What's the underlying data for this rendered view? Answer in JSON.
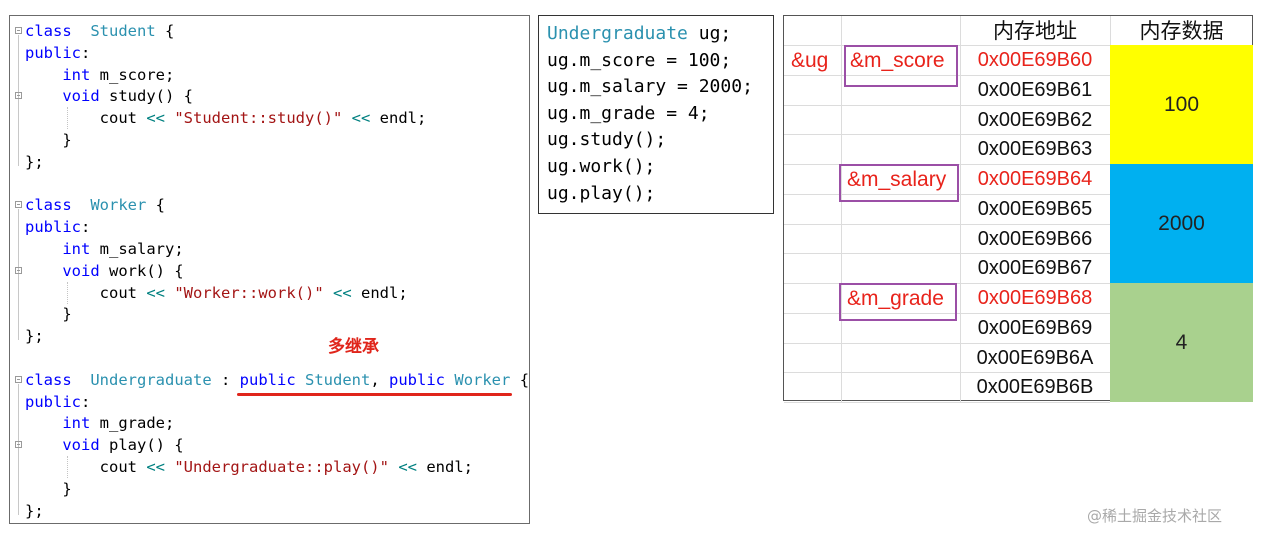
{
  "left_code": {
    "lines": [
      [
        [
          "kw",
          "class"
        ],
        [
          "",
          "  "
        ],
        [
          "ty",
          "Student"
        ],
        [
          "",
          " {"
        ]
      ],
      [
        [
          "kw",
          "public"
        ],
        [
          "",
          ":"
        ]
      ],
      [
        [
          "",
          "    "
        ],
        [
          "kw",
          "int"
        ],
        [
          "",
          " m_score;"
        ]
      ],
      [
        [
          "",
          "    "
        ],
        [
          "kw",
          "void"
        ],
        [
          "",
          " study() {"
        ]
      ],
      [
        [
          "",
          "        cout "
        ],
        [
          "op",
          "<<"
        ],
        [
          "",
          " "
        ],
        [
          "st",
          "\"Student::study()\""
        ],
        [
          "",
          " "
        ],
        [
          "op",
          "<<"
        ],
        [
          "",
          " endl;"
        ]
      ],
      [
        [
          "",
          "    }"
        ]
      ],
      [
        [
          "",
          "};"
        ]
      ],
      [
        [
          "",
          ""
        ]
      ],
      [
        [
          "kw",
          "class"
        ],
        [
          "",
          "  "
        ],
        [
          "ty",
          "Worker"
        ],
        [
          "",
          " {"
        ]
      ],
      [
        [
          "kw",
          "public"
        ],
        [
          "",
          ":"
        ]
      ],
      [
        [
          "",
          "    "
        ],
        [
          "kw",
          "int"
        ],
        [
          "",
          " m_salary;"
        ]
      ],
      [
        [
          "",
          "    "
        ],
        [
          "kw",
          "void"
        ],
        [
          "",
          " work() {"
        ]
      ],
      [
        [
          "",
          "        cout "
        ],
        [
          "op",
          "<<"
        ],
        [
          "",
          " "
        ],
        [
          "st",
          "\"Worker::work()\""
        ],
        [
          "",
          " "
        ],
        [
          "op",
          "<<"
        ],
        [
          "",
          " endl;"
        ]
      ],
      [
        [
          "",
          "    }"
        ]
      ],
      [
        [
          "",
          "};"
        ]
      ],
      [
        [
          "",
          ""
        ]
      ],
      [
        [
          "kw",
          "class"
        ],
        [
          "",
          "  "
        ],
        [
          "ty",
          "Undergraduate"
        ],
        [
          "",
          " : "
        ],
        [
          "kw",
          "public"
        ],
        [
          "",
          " "
        ],
        [
          "ty",
          "Student"
        ],
        [
          "",
          ", "
        ],
        [
          "kw",
          "public"
        ],
        [
          "",
          " "
        ],
        [
          "ty",
          "Worker"
        ],
        [
          "",
          " {"
        ]
      ],
      [
        [
          "kw",
          "public"
        ],
        [
          "",
          ":"
        ]
      ],
      [
        [
          "",
          "    "
        ],
        [
          "kw",
          "int"
        ],
        [
          "",
          " m_grade;"
        ]
      ],
      [
        [
          "",
          "    "
        ],
        [
          "kw",
          "void"
        ],
        [
          "",
          " play() {"
        ]
      ],
      [
        [
          "",
          "        cout "
        ],
        [
          "op",
          "<<"
        ],
        [
          "",
          " "
        ],
        [
          "st",
          "\"Undergraduate::play()\""
        ],
        [
          "",
          " "
        ],
        [
          "op",
          "<<"
        ],
        [
          "",
          " endl;"
        ]
      ],
      [
        [
          "",
          "    }"
        ]
      ],
      [
        [
          "",
          "};"
        ]
      ]
    ],
    "annotation": "多继承"
  },
  "mid_code": {
    "lines": [
      [
        [
          "ty",
          "Undergraduate"
        ],
        [
          "",
          " ug;"
        ]
      ],
      [
        [
          "",
          "ug.m_score = 100;"
        ]
      ],
      [
        [
          "",
          "ug.m_salary = 2000;"
        ]
      ],
      [
        [
          "",
          "ug.m_grade = 4;"
        ]
      ],
      [
        [
          "",
          "ug.study();"
        ]
      ],
      [
        [
          "",
          "ug.work();"
        ]
      ],
      [
        [
          "",
          "ug.play();"
        ]
      ]
    ]
  },
  "memory_table": {
    "header_address": "内存地址",
    "header_data": "内存数据",
    "addresses": [
      "0x00E69B60",
      "0x00E69B61",
      "0x00E69B62",
      "0x00E69B63",
      "0x00E69B64",
      "0x00E69B65",
      "0x00E69B66",
      "0x00E69B67",
      "0x00E69B68",
      "0x00E69B69",
      "0x00E69B6A",
      "0x00E69B6B"
    ],
    "highlighted_addresses": [
      0,
      4,
      8
    ],
    "object_pointer": "&ug",
    "member_pointers": [
      "&m_score",
      "&m_salary",
      "&m_grade"
    ],
    "data_blocks": [
      {
        "value": "100",
        "color": "#ffff00"
      },
      {
        "value": "2000",
        "color": "#00b0f0"
      },
      {
        "value": "4",
        "color": "#a9d18e"
      }
    ]
  },
  "watermark": "@稀土掘金技术社区"
}
